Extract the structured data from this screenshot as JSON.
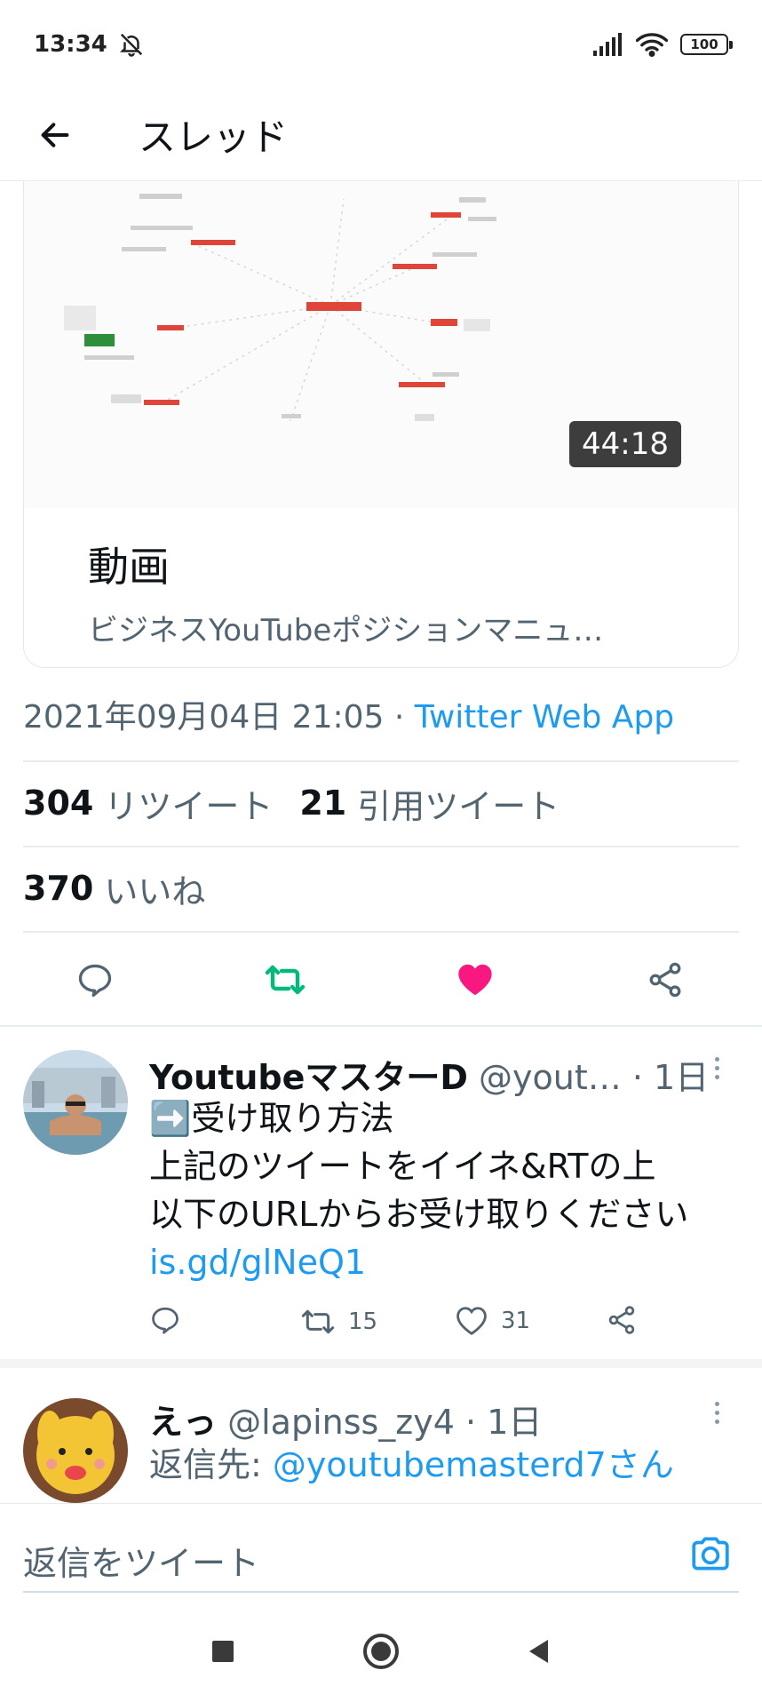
{
  "status_bar": {
    "time": "13:34",
    "battery": "100"
  },
  "header": {
    "title": "スレッド"
  },
  "card": {
    "duration": "44:18",
    "title": "動画",
    "description": "ビジネスYouTubeポジションマニュ…"
  },
  "tweet_meta": {
    "datetime": "2021年09月04日 21:05",
    "separator": " · ",
    "via": "Twitter Web App"
  },
  "stats": {
    "retweets": "304",
    "retweets_label": "リツイート",
    "quotes": "21",
    "quotes_label": "引用ツイート",
    "likes": "370",
    "likes_label": "いいね"
  },
  "colors": {
    "retweet_green": "#00ba7c",
    "like_pink": "#f91880",
    "link_blue": "#1d9bf0"
  },
  "replies": [
    {
      "name": "YoutubeマスターD",
      "handle": "@yout…",
      "time": " · 1日",
      "line1": "➡️受け取り方法",
      "line2": "上記のツイートをイイネ&RTの上",
      "line3": "以下のURLからお受け取りください",
      "link": "is.gd/glNeQ1",
      "retweet_count": "15",
      "like_count": "31"
    },
    {
      "name": "えっ",
      "handle": "@lapinss_zy4",
      "time": " · 1日",
      "reply_to_label": "返信先: ",
      "reply_to": "@youtubemasterd7さん"
    }
  ],
  "compose": {
    "placeholder": "返信をツイート"
  },
  "icons": [
    "back-arrow-icon",
    "reply-icon",
    "retweet-icon",
    "heart-icon",
    "share-icon",
    "camera-icon",
    "more-icon"
  ]
}
